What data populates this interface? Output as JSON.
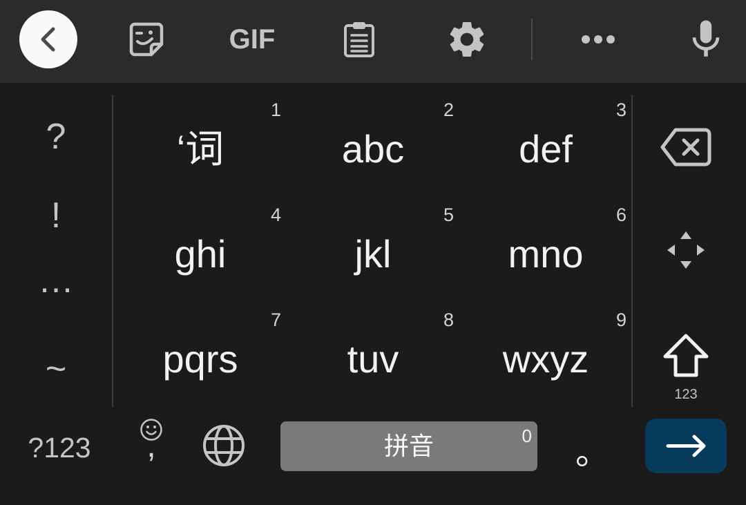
{
  "colors": {
    "toolbar_bg": "#2b2b2b",
    "keyboard_bg": "#1b1b1b",
    "divider": "#3b3b3b",
    "toolbar_divider": "#4a4a4a",
    "icon": "#c4c4c4",
    "text": "#f2f2f2",
    "number": "#d4d4d4",
    "back_button_bg": "#fafafa",
    "back_icon": "#4b4b4b",
    "space_bg": "#7a7a7a",
    "enter_bg": "#073b5e"
  },
  "toolbar": {
    "back_icon": "chevron-left-icon",
    "sticker_icon": "sticker-icon",
    "gif_label": "GIF",
    "clipboard_icon": "clipboard-icon",
    "settings_icon": "gear-icon",
    "more_icon": "more-horizontal-icon",
    "mic_icon": "mic-icon"
  },
  "symbols": [
    "?",
    "!",
    "…",
    "~"
  ],
  "keys": [
    {
      "number": "1",
      "label": "‘词"
    },
    {
      "number": "2",
      "label": "abc"
    },
    {
      "number": "3",
      "label": "def"
    },
    {
      "number": "4",
      "label": "ghi"
    },
    {
      "number": "5",
      "label": "jkl"
    },
    {
      "number": "6",
      "label": "mno"
    },
    {
      "number": "7",
      "label": "pqrs"
    },
    {
      "number": "8",
      "label": "tuv"
    },
    {
      "number": "9",
      "label": "wxyz"
    }
  ],
  "function_keys": {
    "backspace_icon": "backspace-icon",
    "cursor_icon": "cursor-move-icon",
    "shift_icon": "shift-arrow-icon",
    "shift_sublabel": "123"
  },
  "bottom_row": {
    "symbols_label": "?123",
    "emoji_icon": "emoji-icon",
    "comma": ",",
    "globe_icon": "globe-icon",
    "space_label": "拼音",
    "space_counter": "0",
    "period": "。",
    "enter_icon": "arrow-right-icon"
  }
}
